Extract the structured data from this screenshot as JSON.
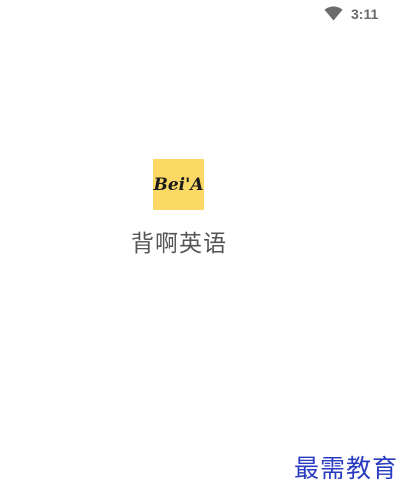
{
  "status_bar": {
    "time": "3:11",
    "wifi_icon": "wifi-icon"
  },
  "splash": {
    "logo_icon": "beia-logo-icon",
    "logo_text": "Bei'A",
    "logo_color": "#fcd964",
    "app_name": "背啊英语"
  },
  "watermark": {
    "text": "最需教育",
    "color": "#2a3cc0"
  }
}
